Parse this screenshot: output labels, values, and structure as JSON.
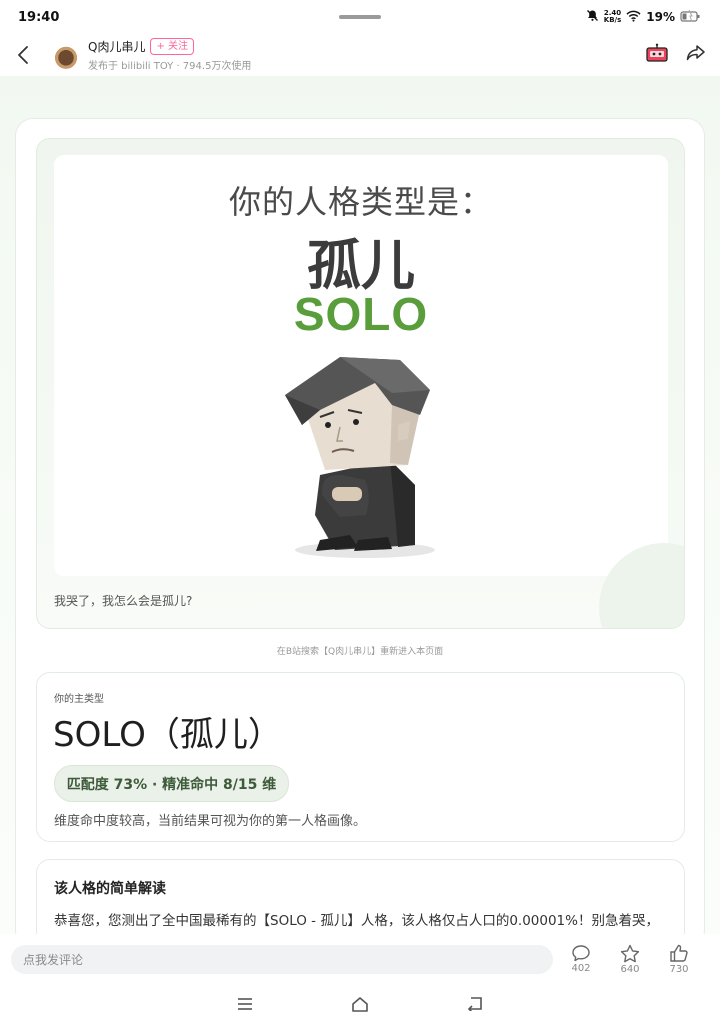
{
  "status_bar": {
    "time": "19:40",
    "net_speed_value": "2.40",
    "net_speed_unit": "KB/s",
    "battery": "19%"
  },
  "header": {
    "author_name": "Q肉儿串儿",
    "follow_label": "+ 关注",
    "meta": "发布于 bilibili TOY · 794.5万次使用"
  },
  "result": {
    "headline": "你的人格类型是：",
    "type_cn": "孤儿",
    "type_en": "SOLO",
    "caption": "我哭了，我怎么会是孤儿?"
  },
  "hint": "在B站搜索【Q肉儿串儿】重新进入本页面",
  "main_type": {
    "label": "你的主类型",
    "title": "SOLO（孤儿）",
    "match": "匹配度 73% · 精准命中 8/15 维",
    "description": "维度命中度较高，当前结果可视为你的第一人格画像。"
  },
  "interpretation": {
    "title": "该人格的简单解读",
    "text": "恭喜您，您测出了全中国最稀有的【SOLO - 孤儿】人格，该人格仅占人口的0.00001%！别急着哭，"
  },
  "comment_bar": {
    "placeholder": "点我发评论",
    "comments": "402",
    "favorites": "640",
    "likes": "730"
  },
  "colors": {
    "accent_green": "#5a9e3c",
    "follow_pink": "#ff6699",
    "background_tint": "#f2f8f1"
  },
  "icons": [
    "back-icon",
    "dnd-bell-icon",
    "wifi-icon",
    "battery-icon",
    "toy-robot-icon",
    "share-icon",
    "comment-icon",
    "star-icon",
    "like-icon",
    "menu-icon",
    "home-icon",
    "back-nav-icon"
  ]
}
